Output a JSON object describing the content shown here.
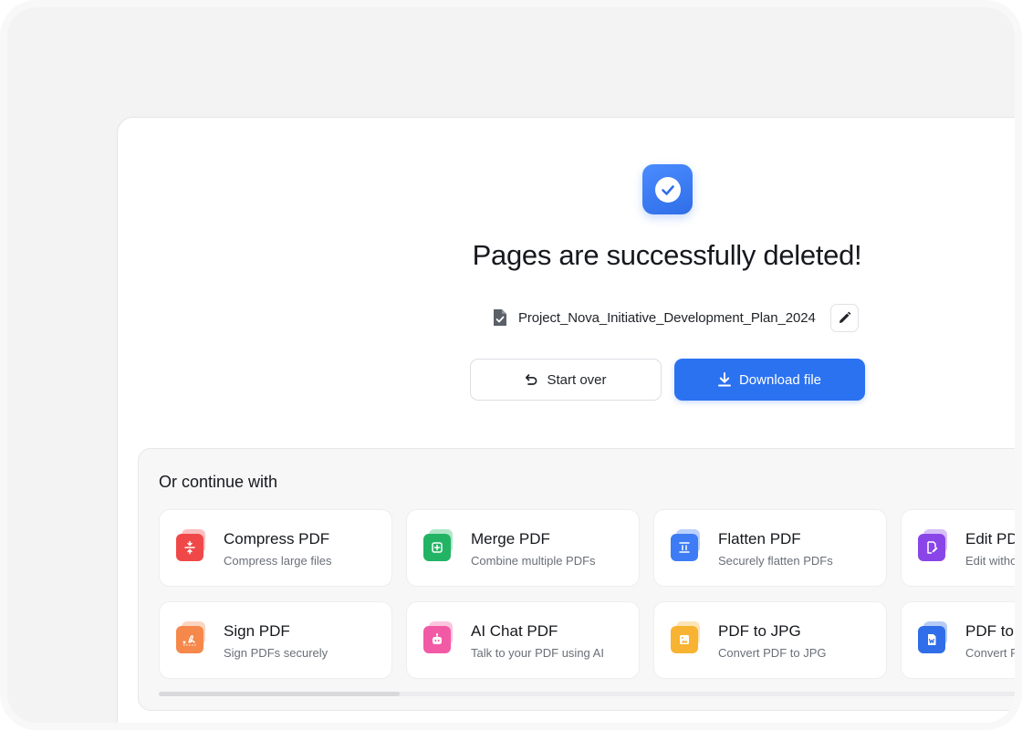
{
  "success": {
    "icon": "check-circle-icon",
    "title": "Pages are successfully deleted!",
    "file_name": "Project_Nova_Initiative_Development_Plan_2024"
  },
  "actions": {
    "start_over_label": "Start over",
    "download_label": "Download file"
  },
  "continue": {
    "title": "Or continue with",
    "tools": [
      {
        "name": "Compress PDF",
        "desc": "Compress large files",
        "icon": "compress-icon",
        "color": "#f04848"
      },
      {
        "name": "Merge PDF",
        "desc": "Combine multiple PDFs",
        "icon": "merge-icon",
        "color": "#22b464"
      },
      {
        "name": "Flatten PDF",
        "desc": "Securely flatten PDFs",
        "icon": "flatten-icon",
        "color": "#3d7cf5"
      },
      {
        "name": "Edit PDF",
        "desc": "Edit without",
        "icon": "edit-pdf-icon",
        "color": "#8a45e8"
      },
      {
        "name": "Sign PDF",
        "desc": "Sign PDFs securely",
        "icon": "signature-icon",
        "color": "#f5884a"
      },
      {
        "name": "AI Chat PDF",
        "desc": "Talk to your PDF using AI",
        "icon": "ai-chat-icon",
        "color": "#f35aa6"
      },
      {
        "name": "PDF to JPG",
        "desc": "Convert PDF to JPG",
        "icon": "image-icon",
        "color": "#f7b331"
      },
      {
        "name": "PDF to W",
        "desc": "Convert PD",
        "icon": "word-icon",
        "color": "#2f6ee8"
      }
    ]
  },
  "colors": {
    "primary": "#2b72f0",
    "background": "#f3f3f4"
  }
}
